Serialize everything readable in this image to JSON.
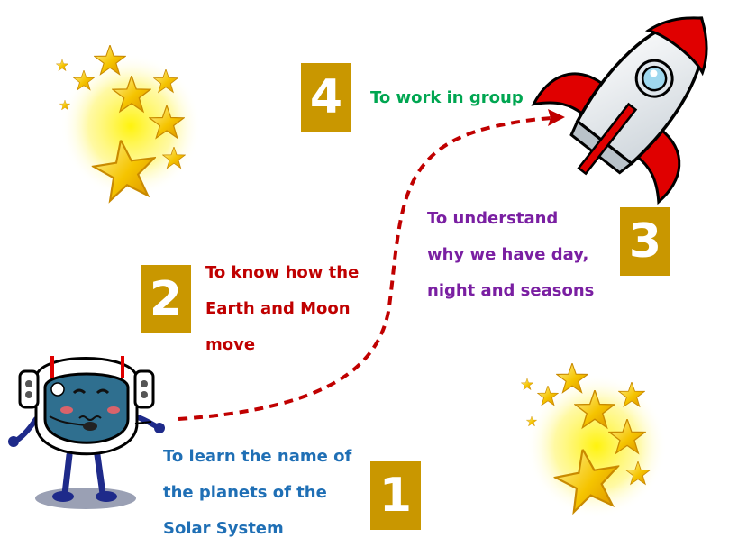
{
  "steps": [
    {
      "number": "1",
      "lines": [
        "To learn the name of",
        "the planets of the",
        "Solar System"
      ],
      "color": "#1f6fb5"
    },
    {
      "number": "2",
      "lines": [
        "To know how the",
        "Earth and Moon",
        "move"
      ],
      "color": "#c00000"
    },
    {
      "number": "3",
      "lines": [
        "To understand",
        "why we have day,",
        "night and seasons"
      ],
      "color": "#7a1fa2"
    },
    {
      "number": "4",
      "lines": [
        "To work in group"
      ],
      "color": "#00a651"
    }
  ],
  "colors": {
    "box": "#c99700",
    "path": "#c00000",
    "star": "#f5c400",
    "rocket_red": "#e00000",
    "helmet_visor": "#2f6f8f"
  },
  "icons": [
    "star-cluster-icon",
    "rocket-icon",
    "astronaut-icon"
  ]
}
